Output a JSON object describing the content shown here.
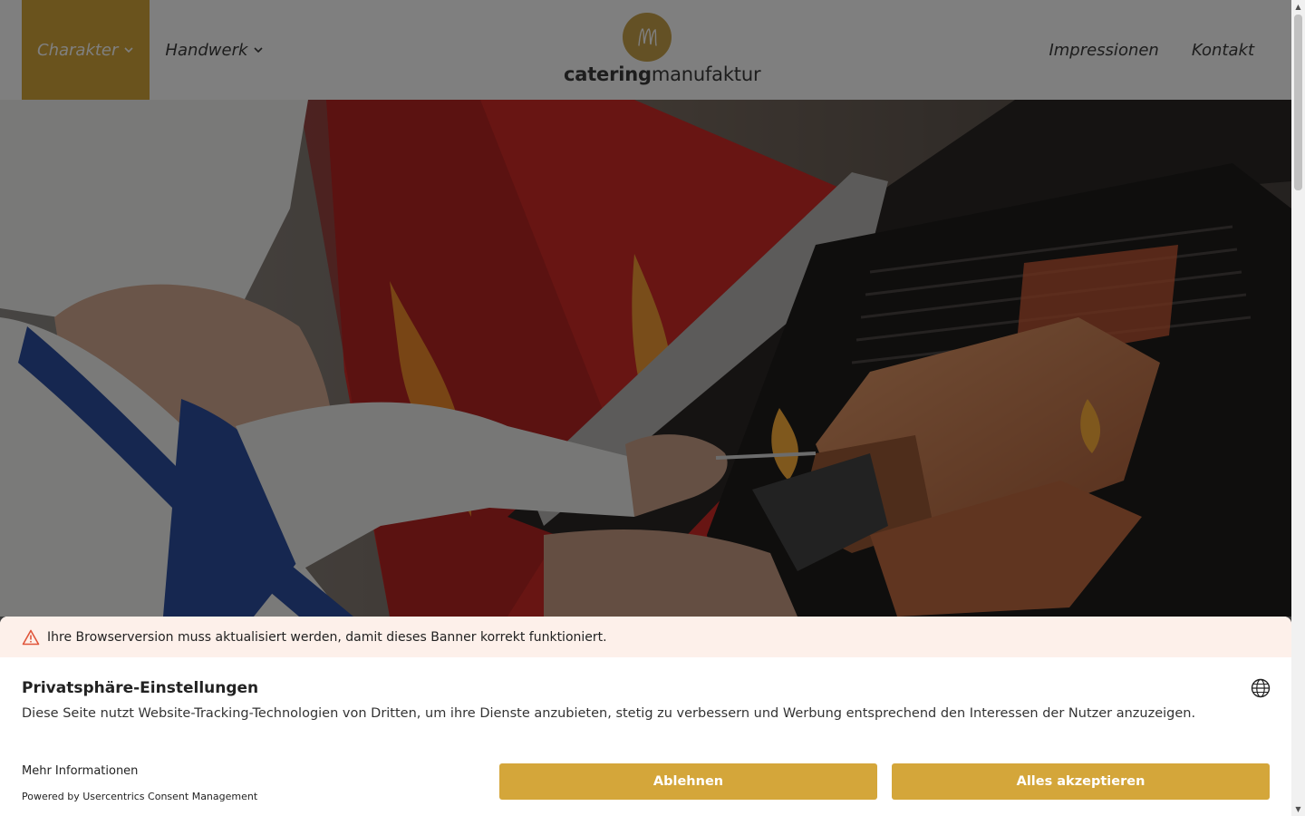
{
  "nav": {
    "left": [
      {
        "label": "Charakter",
        "active": true
      },
      {
        "label": "Handwerk",
        "active": false
      }
    ],
    "right": [
      {
        "label": "Impressionen"
      },
      {
        "label": "Kontakt"
      }
    ]
  },
  "logo": {
    "text_bold": "catering",
    "text_light": "manufaktur",
    "monogram": "m"
  },
  "hero": {
    "image": "chef-grilling-salmon"
  },
  "consent": {
    "warning": "Ihre Browserversion muss aktualisiert werden, damit dieses Banner korrekt funktioniert.",
    "title": "Privatsphäre-Einstellungen",
    "description": "Diese Seite nutzt Website-Tracking-Technologien von Dritten, um ihre Dienste anzubieten, stetig zu verbessern und Werbung entsprechend den Interessen der Nutzer anzuzeigen.",
    "more_info": "Mehr Informationen",
    "powered_by": "Powered by Usercentrics Consent Management",
    "deny_label": "Ablehnen",
    "accept_label": "Alles akzeptieren"
  },
  "colors": {
    "accent": "#d4a63a",
    "logo_circle": "#c9a24a",
    "warning_bg": "#fdf0ea",
    "warning_icon": "#e0553a"
  }
}
